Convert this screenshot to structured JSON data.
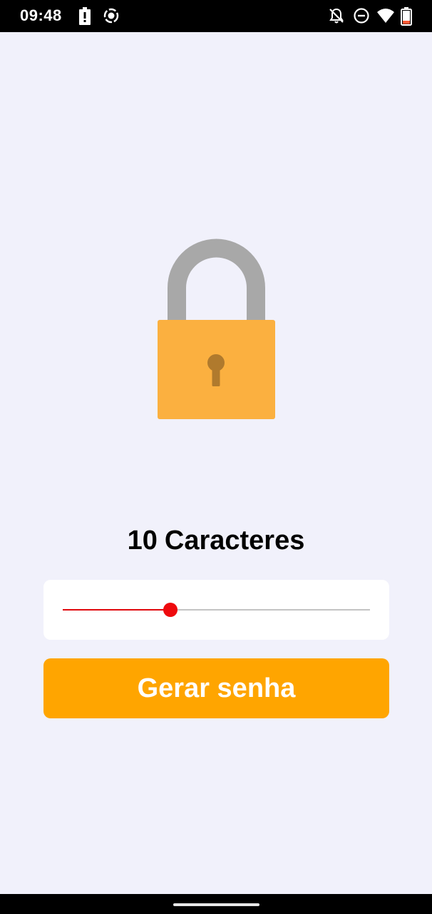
{
  "status_bar": {
    "time": "09:48",
    "icons": [
      "battery-alert-icon",
      "record-icon",
      "notifications-off-icon",
      "do-not-disturb-icon",
      "wifi-icon",
      "battery-icon"
    ]
  },
  "illustration": {
    "icon": "padlock-icon",
    "colors": {
      "shackle": "#a8a8a8",
      "body": "#fbb040",
      "keyhole": "#b07a2d"
    }
  },
  "length": {
    "value": "10",
    "label": "Caracteres"
  },
  "slider": {
    "fraction": 0.35,
    "colors": {
      "active": "#e0080d",
      "inactive": "#c3c3c3",
      "thumb": "#ee0a0e"
    }
  },
  "button": {
    "label": "Gerar senha",
    "color": "#ffa500"
  },
  "colors": {
    "background": "#f1f1fb"
  }
}
